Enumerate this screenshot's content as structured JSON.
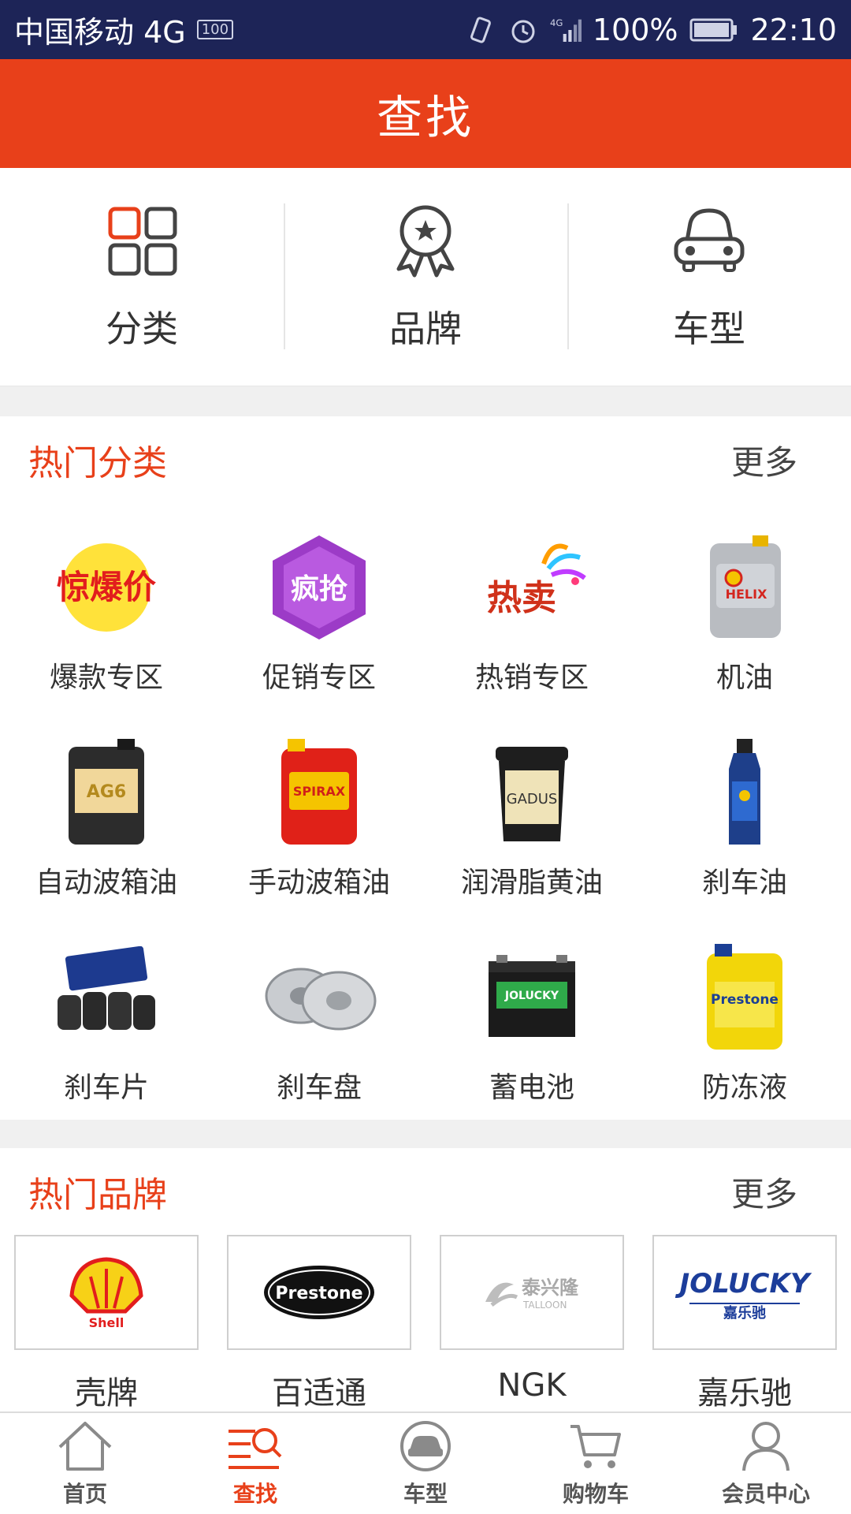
{
  "status_bar": {
    "carrier": "中国移动 4G",
    "battery_small": "100",
    "net": "4G",
    "battery_pct": "100%",
    "time": "22:10"
  },
  "header": {
    "title": "查找"
  },
  "quick_nav": [
    {
      "label": "分类",
      "icon": "grid-icon"
    },
    {
      "label": "品牌",
      "icon": "award-icon"
    },
    {
      "label": "车型",
      "icon": "car-icon"
    }
  ],
  "hot_categories": {
    "title": "热门分类",
    "more": "更多",
    "items": [
      {
        "label": "爆款专区",
        "image_text": "惊爆价"
      },
      {
        "label": "促销专区",
        "image_text": "疯抢"
      },
      {
        "label": "热销专区",
        "image_text": "热卖"
      },
      {
        "label": "机油",
        "image_text": "HELIX"
      },
      {
        "label": "自动波箱油",
        "image_text": "AG6"
      },
      {
        "label": "手动波箱油",
        "image_text": "SPIRAX"
      },
      {
        "label": "润滑脂黄油",
        "image_text": "GADUS"
      },
      {
        "label": "刹车油",
        "image_text": ""
      },
      {
        "label": "刹车片",
        "image_text": ""
      },
      {
        "label": "刹车盘",
        "image_text": ""
      },
      {
        "label": "蓄电池",
        "image_text": "JOLUCKY"
      },
      {
        "label": "防冻液",
        "image_text": "Prestone"
      }
    ]
  },
  "hot_brands": {
    "title": "热门品牌",
    "more": "更多",
    "items": [
      {
        "name": "壳牌",
        "logo_text": "Shell"
      },
      {
        "name": "百适通",
        "logo_text": "Prestone"
      },
      {
        "name": "NGK",
        "logo_text": "泰兴隆",
        "logo_sub": "TALLOON"
      },
      {
        "name": "嘉乐驰",
        "logo_text": "JOLUCKY",
        "logo_sub": "嘉乐驰"
      }
    ]
  },
  "tab_bar": [
    {
      "label": "首页",
      "icon": "home-icon",
      "active": false
    },
    {
      "label": "查找",
      "icon": "search-list-icon",
      "active": true
    },
    {
      "label": "车型",
      "icon": "car-circle-icon",
      "active": false
    },
    {
      "label": "购物车",
      "icon": "cart-icon",
      "active": false
    },
    {
      "label": "会员中心",
      "icon": "user-icon",
      "active": false
    }
  ],
  "colors": {
    "accent": "#e8401a",
    "status_bar": "#1d2457",
    "divider": "#f0f0f0"
  }
}
